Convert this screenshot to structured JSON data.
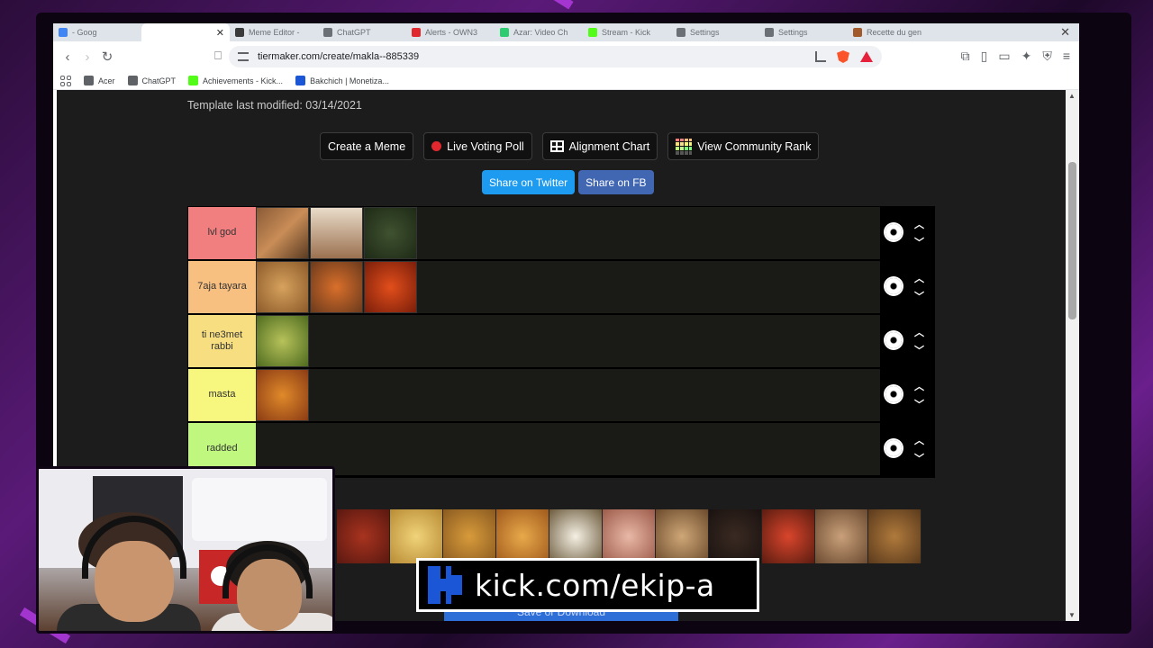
{
  "browser": {
    "tabs": [
      {
        "label": "- Goog",
        "color": "#4285f4",
        "active": false
      },
      {
        "label": "",
        "color": "#ffffff",
        "active": true
      },
      {
        "label": "Meme Editor -",
        "color": "#3a3a3a",
        "active": false
      },
      {
        "label": "ChatGPT",
        "color": "#6b6f76",
        "active": false
      },
      {
        "label": "Alerts - OWN3",
        "color": "#e0282e",
        "active": false
      },
      {
        "label": "Azar: Video Ch",
        "color": "#2ecc71",
        "active": false
      },
      {
        "label": "Stream - Kick",
        "color": "#53fc18",
        "active": false
      },
      {
        "label": "Settings",
        "color": "#6b6f76",
        "active": false
      },
      {
        "label": "Settings",
        "color": "#6b6f76",
        "active": false
      },
      {
        "label": "Recette du gen",
        "color": "#a05a2c",
        "active": false
      }
    ],
    "url": "tiermaker.com/create/makla--885339",
    "bookmarks": [
      {
        "label": "Acer",
        "icon": "folder-icon",
        "color": "#5f6368"
      },
      {
        "label": "ChatGPT",
        "icon": "chatgpt-icon",
        "color": "#5f6368"
      },
      {
        "label": "Achievements - Kick...",
        "icon": "kick-icon",
        "color": "#53fc18"
      },
      {
        "label": "Bakchich | Monetiza...",
        "icon": "bakchich-icon",
        "color": "#1a56d6"
      }
    ]
  },
  "page": {
    "modified": "Template last modified: 03/14/2021",
    "actions": {
      "create_meme": "Create a Meme",
      "live_poll": "Live Voting Poll",
      "alignment": "Alignment Chart",
      "community": "View Community Rank"
    },
    "share": {
      "twitter": "Share on Twitter",
      "fb": "Share on FB"
    },
    "tiers": [
      {
        "label": "lvl god",
        "color": "#f27f7f",
        "items": 3
      },
      {
        "label": "7aja tayara",
        "color": "#f7bf80",
        "items": 3
      },
      {
        "label": "ti ne3met rabbi",
        "color": "#f7de80",
        "items": 1
      },
      {
        "label": "masta",
        "color": "#f7f780",
        "items": 1
      },
      {
        "label": "radded",
        "color": "#bff77f",
        "items": 0
      }
    ],
    "pool_count": 11,
    "save_label": "Save or Download"
  },
  "overlay": {
    "kick_text": "kick.com/ekip-a"
  }
}
